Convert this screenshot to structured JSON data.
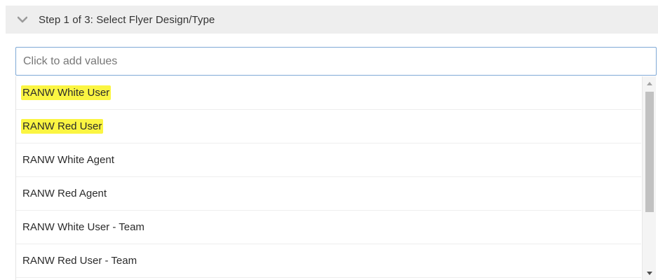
{
  "step_header": {
    "icon": "chevron-down-icon",
    "title": "Step 1 of 3: Select Flyer Design/Type"
  },
  "search": {
    "placeholder": "Click to add values",
    "value": ""
  },
  "options": [
    {
      "label": "RANW White User",
      "highlighted": true
    },
    {
      "label": "RANW Red User",
      "highlighted": true
    },
    {
      "label": "RANW White Agent",
      "highlighted": false
    },
    {
      "label": "RANW Red Agent",
      "highlighted": false
    },
    {
      "label": "RANW White User - Team",
      "highlighted": false
    },
    {
      "label": "RANW Red User - Team",
      "highlighted": false
    }
  ],
  "colors": {
    "header_bg": "#eeeeee",
    "input_border": "#7fa9d6",
    "highlight": "#fbf542"
  },
  "scrollbar": {
    "icons": [
      "scroll-up-arrow-icon",
      "scroll-down-arrow-icon"
    ]
  }
}
